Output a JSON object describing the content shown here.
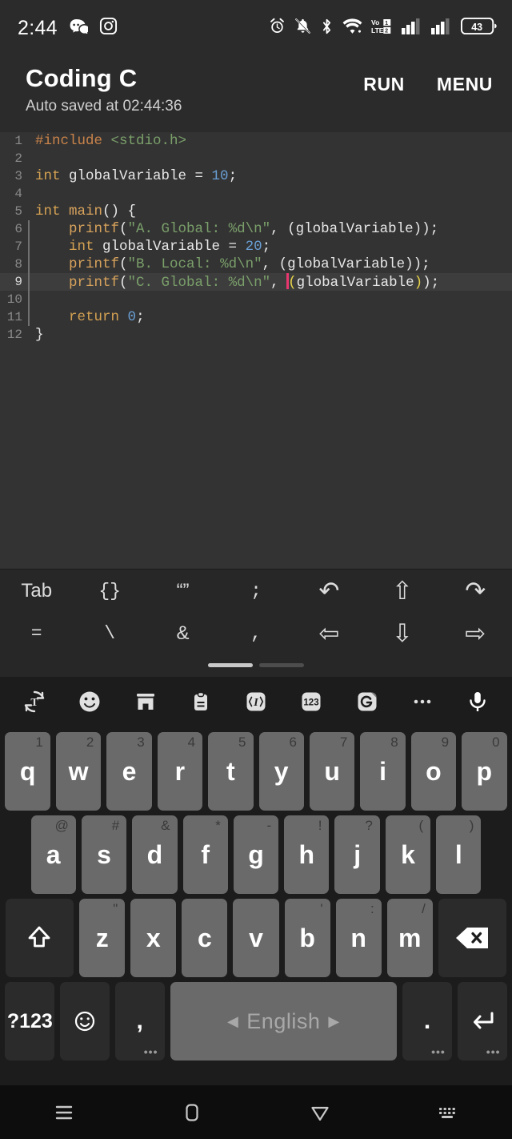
{
  "status_bar": {
    "time": "2:44",
    "notification_icons": [
      "discord-icon",
      "instagram-icon"
    ],
    "system_icons": [
      "alarm-icon",
      "notifications-muted-icon",
      "bluetooth-icon",
      "wifi-icon",
      "volte-icon",
      "signal-sim1-icon",
      "signal-sim2-icon"
    ],
    "battery_level": "43"
  },
  "header": {
    "title": "Coding C",
    "subtitle": "Auto saved at 02:44:36",
    "run_label": "RUN",
    "menu_label": "MENU"
  },
  "editor": {
    "active_line": 9,
    "lines": [
      {
        "n": "1",
        "guide": false,
        "active": false
      },
      {
        "n": "2",
        "guide": false,
        "active": false
      },
      {
        "n": "3",
        "guide": false,
        "active": false
      },
      {
        "n": "4",
        "guide": false,
        "active": false
      },
      {
        "n": "5",
        "guide": false,
        "active": false
      },
      {
        "n": "6",
        "guide": true,
        "active": false
      },
      {
        "n": "7",
        "guide": true,
        "active": false
      },
      {
        "n": "8",
        "guide": true,
        "active": false
      },
      {
        "n": "9",
        "guide": true,
        "active": true
      },
      {
        "n": "10",
        "guide": true,
        "active": false
      },
      {
        "n": "11",
        "guide": true,
        "active": false
      },
      {
        "n": "12",
        "guide": false,
        "active": false
      }
    ],
    "source": [
      "#include <stdio.h>",
      "",
      "int globalVariable = 10;",
      "",
      "int main() {",
      "    printf(\"A. Global: %d\\n\", (globalVariable));",
      "    int globalVariable = 20;",
      "    printf(\"B. Local: %d\\n\", (globalVariable));",
      "    printf(\"C. Global: %d\\n\", (globalVariable));",
      "",
      "    return 0;",
      "}"
    ],
    "colors": {
      "background": "#333333",
      "active_line": "#3d3d3d",
      "line_number": "#8a8a8a",
      "preprocessor": "#c9834a",
      "include_path": "#7aa06a",
      "keyword": "#d5a253",
      "function": "#d8a35c",
      "number": "#6a9fd4",
      "string": "#7a9f6a",
      "plain": "#e8e8e8",
      "matching_paren": "#e8d44a",
      "caret": "#e8376f"
    }
  },
  "symbol_bar": {
    "row1": [
      "Tab",
      "{}",
      "“”",
      ";",
      "undo-icon",
      "arrow-up-icon",
      "redo-icon"
    ],
    "row2": [
      "=",
      "\\",
      "&",
      ",",
      "arrow-left-icon",
      "arrow-down-icon",
      "arrow-right-icon"
    ],
    "row1_glyphs": [
      "Tab",
      "{}",
      "“”",
      ";",
      "↶",
      "⇧",
      "↷"
    ],
    "row2_glyphs": [
      "=",
      "\\",
      "&",
      ",",
      "⇦",
      "⇩",
      "⇨"
    ],
    "pages": 2,
    "active_page": 1
  },
  "keyboard": {
    "toolbar_icons": [
      "translate-icon",
      "emoji-icon",
      "store-icon",
      "clipboard-icon",
      "text-edit-icon",
      "numbers-icon",
      "gif-icon",
      "more-icon",
      "mic-icon"
    ],
    "numbers_badge": "123",
    "row1": [
      {
        "key": "q",
        "hint": "1"
      },
      {
        "key": "w",
        "hint": "2"
      },
      {
        "key": "e",
        "hint": "3"
      },
      {
        "key": "r",
        "hint": "4"
      },
      {
        "key": "t",
        "hint": "5"
      },
      {
        "key": "y",
        "hint": "6"
      },
      {
        "key": "u",
        "hint": "7"
      },
      {
        "key": "i",
        "hint": "8"
      },
      {
        "key": "o",
        "hint": "9"
      },
      {
        "key": "p",
        "hint": "0"
      }
    ],
    "row2": [
      {
        "key": "a",
        "hint": "@"
      },
      {
        "key": "s",
        "hint": "#"
      },
      {
        "key": "d",
        "hint": "&"
      },
      {
        "key": "f",
        "hint": "*"
      },
      {
        "key": "g",
        "hint": "-"
      },
      {
        "key": "h",
        "hint": "!"
      },
      {
        "key": "j",
        "hint": "?"
      },
      {
        "key": "k",
        "hint": "("
      },
      {
        "key": "l",
        "hint": ")"
      }
    ],
    "row3": [
      {
        "key": "z",
        "hint": "\""
      },
      {
        "key": "x",
        "hint": ""
      },
      {
        "key": "c",
        "hint": ""
      },
      {
        "key": "v",
        "hint": ""
      },
      {
        "key": "b",
        "hint": "'"
      },
      {
        "key": "n",
        "hint": ":"
      },
      {
        "key": "m",
        "hint": "/"
      }
    ],
    "shift_label": "shift-icon",
    "backspace_label": "backspace-icon",
    "symbols_label": "?123",
    "emoji_label": "emoji-icon",
    "comma_label": ",",
    "space_label": "English",
    "period_label": ".",
    "enter_label": "enter-icon"
  },
  "nav_bar": {
    "items": [
      "recents-icon",
      "home-icon",
      "back-icon",
      "hide-keyboard-icon"
    ]
  }
}
